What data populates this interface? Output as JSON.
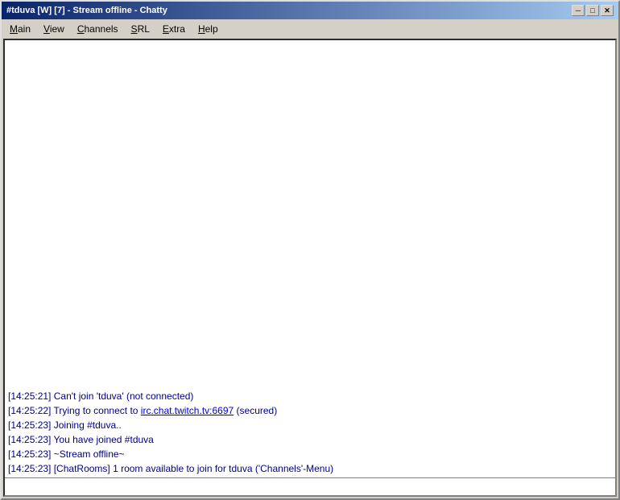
{
  "window": {
    "title": "#tduva [W] [7] - Stream offline - Chatty",
    "app_name": "Chatty"
  },
  "controls": {
    "minimize": "─",
    "maximize": "□",
    "close": "✕"
  },
  "menu": {
    "items": [
      {
        "label": "Main",
        "key": "M"
      },
      {
        "label": "View",
        "key": "V"
      },
      {
        "label": "Channels",
        "key": "C"
      },
      {
        "label": "SRL",
        "key": "S"
      },
      {
        "label": "Extra",
        "key": "E"
      },
      {
        "label": "Help",
        "key": "H"
      }
    ]
  },
  "messages": [
    {
      "time": "[14:25:21]",
      "text": " Can't join 'tduva' (not connected)",
      "has_link": false
    },
    {
      "time": "[14:25:22]",
      "text_before": " Trying to connect to ",
      "link": "irc.chat.twitch.tv:6697",
      "text_after": " (secured)",
      "has_link": true
    },
    {
      "time": "[14:25:23]",
      "text": " Joining #tduva..",
      "has_link": false
    },
    {
      "time": "[14:25:23]",
      "text": " You have joined #tduva",
      "has_link": false
    },
    {
      "time": "[14:25:23]",
      "text": " ~Stream offline~",
      "has_link": false
    },
    {
      "time": "[14:25:23]",
      "text": " [ChatRooms] 1 room available to join for tduva ('Channels'-Menu)",
      "has_link": false
    }
  ],
  "input": {
    "placeholder": ""
  }
}
